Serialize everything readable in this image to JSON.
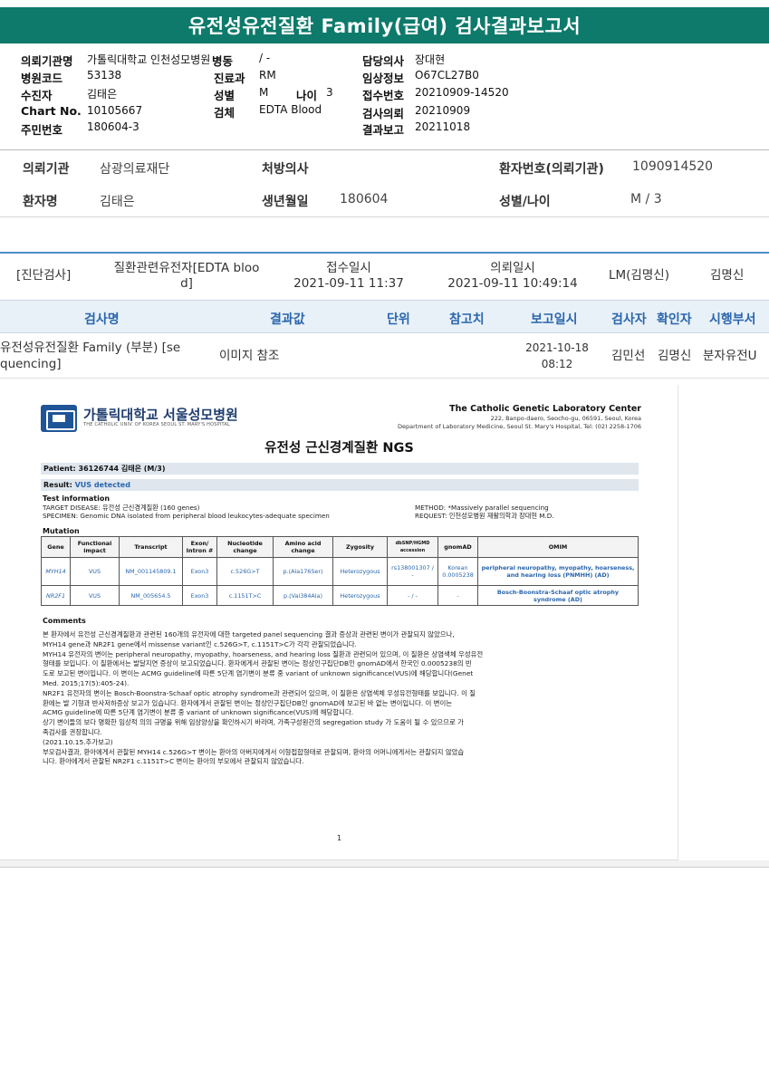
{
  "title": "유전성유전질환 Family(급여) 검사결과보고서",
  "header": {
    "col1": [
      {
        "label": "의뢰기관명",
        "value": "가톨릭대학교 인천성모병원"
      },
      {
        "label": "병원코드",
        "value": "53138"
      },
      {
        "label": "수진자",
        "value": "김태은"
      },
      {
        "label": "Chart No.",
        "value": "10105667"
      },
      {
        "label": "주민번호",
        "value": "180604-3"
      }
    ],
    "col2": [
      {
        "label": "병동",
        "value": "/ -"
      },
      {
        "label": "진료과",
        "value": "RM"
      },
      {
        "label": "성별",
        "value": "M"
      },
      {
        "label": "검체",
        "value": "EDTA Blood"
      }
    ],
    "age_label": "나이",
    "age_value": "3",
    "col3": [
      {
        "label": "담당의사",
        "value": "장대현"
      },
      {
        "label": "임상정보",
        "value": "O67CL27B0"
      },
      {
        "label": "접수번호",
        "value": "20210909-14520"
      },
      {
        "label": "검사의뢰",
        "value": "20210909"
      },
      {
        "label": "결과보고",
        "value": "20211018"
      }
    ]
  },
  "patient_info": {
    "institution_label": "의뢰기관",
    "institution_value": "삼광의료재단",
    "doctor_label": "처방의사",
    "doctor_value": "",
    "patient_no_label": "환자번호(의뢰기관)",
    "patient_no_value": "1090914520",
    "name_label": "환자명",
    "name_value": "김태은",
    "birth_label": "생년월일",
    "birth_value": "180604",
    "sexage_label": "성별/나이",
    "sexage_value": "M / 3"
  },
  "order": {
    "category": "[진단검사]",
    "specimen_line1": "질환관련유전자[EDTA bloo",
    "specimen_line2": "d]",
    "received_label": "접수일시",
    "received_value": "2021-09-11 11:37",
    "requested_label": "의뢰일시",
    "requested_value": "2021-09-11 10:49:14",
    "lm": "LM(김명신)",
    "lm_name": "김명신"
  },
  "table": {
    "headers": [
      "검사명",
      "결과값",
      "단위",
      "참고치",
      "보고일시",
      "검사자",
      "확인자",
      "시행부서"
    ],
    "row": {
      "test_line1": "유전성유전질환 Family (부분) [se",
      "test_line2": "quencing]",
      "result": "이미지 참조",
      "unit": "",
      "ref": "",
      "date": "2021-10-18",
      "time": "08:12",
      "tester": "김민선",
      "confirmer": "김명신",
      "dept": "분자유전U"
    }
  },
  "report": {
    "hospital_name": "가톨릭대학교 서울성모병원",
    "hospital_sub": "THE CATHOLIC UNIV. OF KOREA SEOUL ST. MARY'S HOSPITAL",
    "lab_name": "The Catholic Genetic Laboratory Center",
    "lab_addr1": "222, Banpo-daero, Seocho-gu, 06591, Seoul, Korea",
    "lab_addr2": "Department of Laboratory Medicine, Seoul St. Mary's Hospital, Tel: (02) 2258-1706",
    "doc_title": "유전성 근신경계질환 NGS",
    "patient_line": "Patient: 36126744 김태은 (M/3)",
    "result_prefix": "Result: ",
    "result_value": "VUS detected",
    "test_info_title": "Test information",
    "target_disease": "TARGET DISEASE: 유전성 근신경계질환 (160 genes)",
    "specimen": "SPECIMEN: Genomic DNA isolated from peripheral blood leukocytes-adequate specimen",
    "method": "METHOD: *Massively parallel sequencing",
    "request": "REQUEST: 인천성모병원 재활의학과 장대현 M.D.",
    "mutation_title": "Mutation",
    "mut_headers": [
      "Gene",
      "Functional impact",
      "Transcript",
      "Exon/ Intron #",
      "Nucleotide change",
      "Amino acid change",
      "Zygosity",
      "dbSNP/HGMD accession",
      "gnomAD",
      "OMIM"
    ],
    "mutations": [
      {
        "gene": "MYH14",
        "impact": "VUS",
        "transcript": "NM_001145809.1",
        "exon": "Exon3",
        "nt": "c.526G>T",
        "aa": "p.(Ala176Ser)",
        "zyg": "Heterozygous",
        "db": "rs138001307 / -",
        "gnomad": "Korean 0.0005238",
        "omim": "peripheral neuropathy, myopathy, hoarseness, and hearing loss (PNMHH) (AD)"
      },
      {
        "gene": "NR2F1",
        "impact": "VUS",
        "transcript": "NM_005654.5",
        "exon": "Exon3",
        "nt": "c.1151T>C",
        "aa": "p.(Val384Ala)",
        "zyg": "Heterozygous",
        "db": "- / -",
        "gnomad": "-",
        "omim": "Bosch-Boonstra-Schaaf optic atrophy syndrome (AD)"
      }
    ],
    "comments_title": "Comments",
    "comments": [
      "본 환자에서 유전성 근신경계질환과 관련된 160개의 유전자에 대한 targeted panel sequencing 결과 증상과 관련된 변이가 관찰되지 않았으나,",
      "MYH14 gene과 NR2F1 gene에서 missense variant인 c.526G>T, c.1151T>C가 각각 관찰되었습니다.",
      "MYH14 유전자의 변이는 peripheral neuropathy, myopathy, hoarseness, and hearing loss 질환과 관련되어 있으며, 이 질환은 상염색체 우성유전",
      "형태를 보입니다. 이 질환에서는 발달지연 증상이 보고되었습니다. 환자에게서 관찰된 변이는 정상인구집단DB인 gnomAD에서 한국인 0.0005238의 빈",
      "도로 보고된 변이입니다. 이 변이는 ACMG guideline에 따른 5단계 염기변이 분류 중 variant of unknown significance(VUS)에 해당합니다(Genet",
      "Med. 2015;17(5):405-24).",
      "NR2F1 유전자의 변이는 Bosch-Boonstra-Schaaf optic atrophy syndrome과 관련되어 있으며, 이 질환은 상염색체 우성유전형태를 보입니다. 이 질",
      "환에는 발 기형과 반사저하증상 보고가 있습니다. 환자에게서 관찰된 변이는 정상인구집단DB인 gnomAD에 보고된 바 없는 변이입니다. 이 변이는",
      "ACMG guideline에 따른 5단계 염기변이 분류 중 variant of unknown significance(VUS)에 해당합니다.",
      "상기 변이들의 보다 명확한 임상적 의의 규명을 위해 임상양상을 확인하시기 바라며, 가족구성원간의 segregation study 가 도움이 될 수 있으므로 가",
      "족검사를 권장합니다.",
      "(2021.10.15.추가보고)",
      "부모검사결과, 환아에게서 관찰된 MYH14 c.526G>T 변이는 환아의 아버지에게서 이형접합형태로 관찰되며, 환아의 어머니에게서는 관찰되지 않았습",
      "니다. 환아에게서 관찰된 NR2F1 c.1151T>C 변이는 환아의 부모에서 관찰되지 않았습니다."
    ],
    "page_no": "1"
  }
}
